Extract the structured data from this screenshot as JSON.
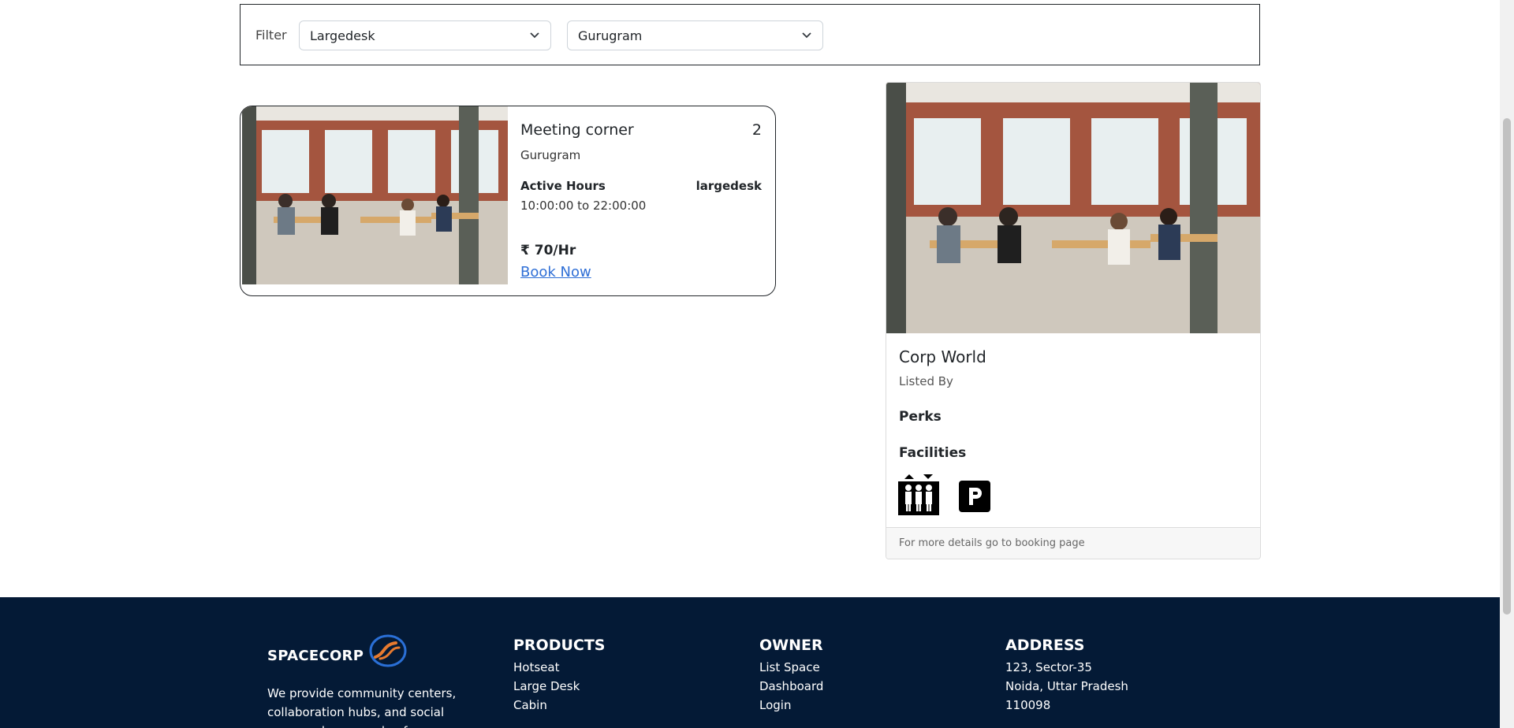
{
  "filter": {
    "label": "Filter",
    "space_type": "Largedesk",
    "city": "Gurugram"
  },
  "listing": {
    "title": "Meeting corner",
    "count": "2",
    "city": "Gurugram",
    "hours_label": "Active Hours",
    "space_type": "largedesk",
    "hours_value": "10:00:00 to 22:00:00",
    "price": "₹ 70/Hr",
    "book_label": "Book Now"
  },
  "detail": {
    "title": "Corp World",
    "listed_by": "Listed By",
    "perks_heading": "Perks",
    "facilities_heading": "Facilities",
    "facilities": [
      "elevator-icon",
      "parking-icon"
    ],
    "footer_note": "For more details go to booking page"
  },
  "footer": {
    "brand": "SPACECORP",
    "description": "We provide community centers, collaboration hubs, and social spaces where people of many different",
    "products": {
      "heading": "PRODUCTS",
      "items": [
        "Hotseat",
        "Large Desk",
        "Cabin"
      ]
    },
    "owner": {
      "heading": "OWNER",
      "items": [
        "List Space",
        "Dashboard",
        "Login"
      ]
    },
    "address": {
      "heading": "ADDRESS",
      "lines": [
        "123, Sector-35",
        "Noida, Uttar Pradesh",
        "110098"
      ]
    }
  },
  "colors": {
    "footer_bg": "#041a36",
    "link": "#2f6fd6"
  }
}
